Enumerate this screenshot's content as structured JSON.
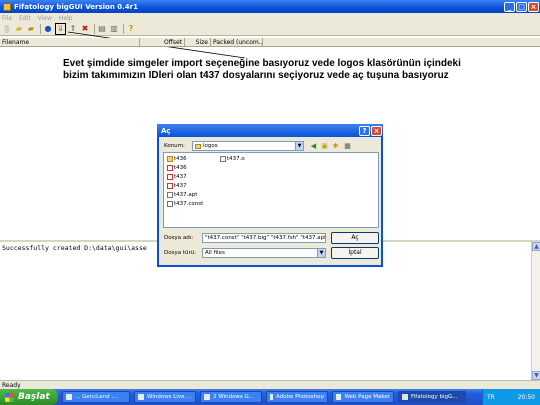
{
  "window": {
    "title": "Fifatology bigGUI Version 0.4r1"
  },
  "menu": [
    "File",
    "Edit",
    "View",
    "Help"
  ],
  "columns": [
    "Filename",
    "Offset",
    "Size",
    "Packed (uncom..."
  ],
  "annotation": {
    "line1": "Evet şimdide simgeler import seçeneğine basıyoruz vede logos klasörünün içindeki",
    "line2": "bizim takımımızın IDleri olan t437 dosyalarını seçiyoruz vede aç tuşuna basıyoruz"
  },
  "log": {
    "text": "Successfully created D:\\data\\gui\\asse"
  },
  "status": {
    "text": "Ready"
  },
  "dialog": {
    "title": "Aç",
    "look_in_label": "Konum:",
    "look_in_value": "logos",
    "files": [
      {
        "name": "t436",
        "type": "folder"
      },
      {
        "name": "t436",
        "type": "file-red"
      },
      {
        "name": "t437",
        "type": "file-red"
      },
      {
        "name": "t437",
        "type": "file-red"
      },
      {
        "name": "t437.apt",
        "type": "file"
      },
      {
        "name": "t437.const",
        "type": "file"
      },
      {
        "name": "t437.o",
        "type": "file"
      }
    ],
    "filename_label": "Dosya adı:",
    "filename_value": "\"t437.const\" \"t437.big\" \"t437.fsh\" \"t437.apt\"",
    "filetype_label": "Dosya türü:",
    "filetype_value": "All files",
    "open_button": "Aç",
    "cancel_button": "İptal"
  },
  "taskbar": {
    "start": "Başlat",
    "tasks": [
      "... GencLand :...",
      "Windows Live ...",
      "2 Windows G...",
      "Adobe Photoshop",
      "Web Page Maker",
      "Fifatology bigG..."
    ],
    "lang": "TR",
    "clock": "20:50"
  }
}
